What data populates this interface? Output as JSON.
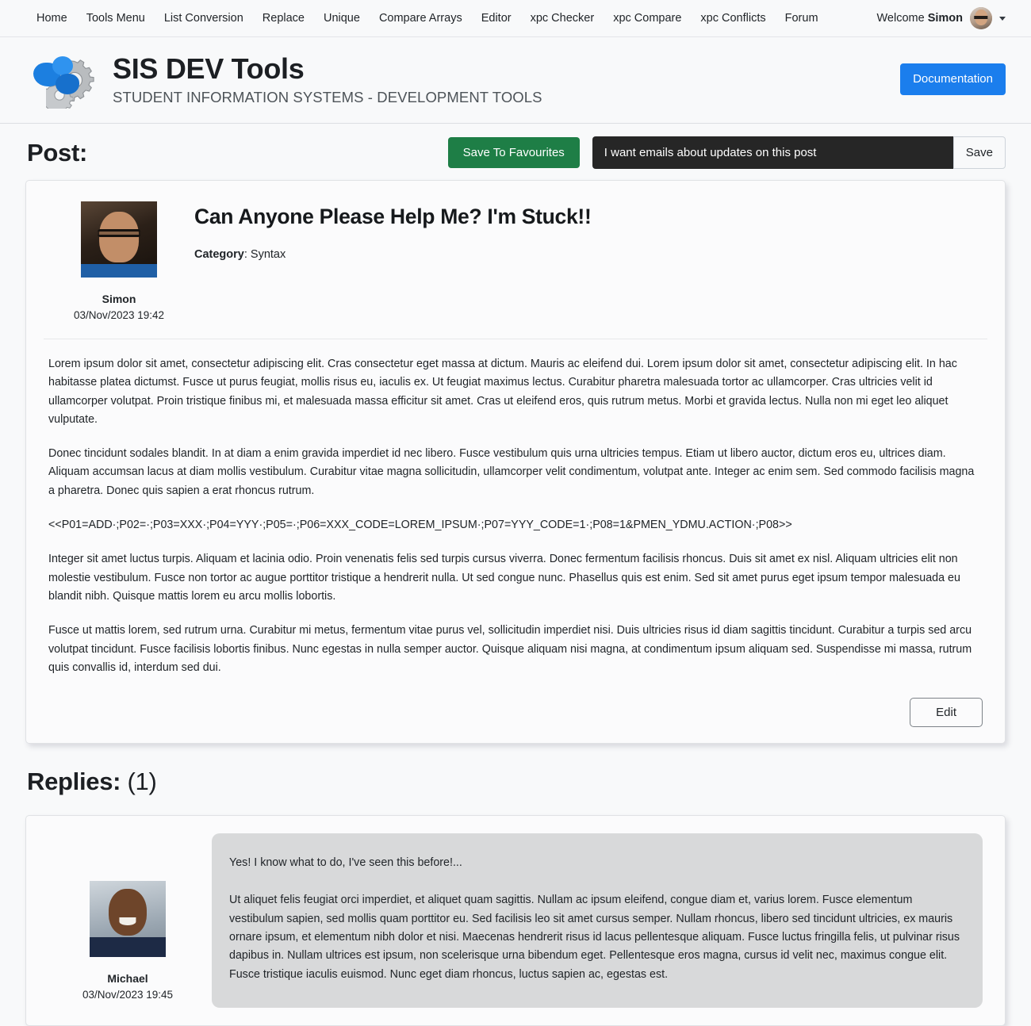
{
  "nav": {
    "links": [
      "Home",
      "Tools Menu",
      "List Conversion",
      "Replace",
      "Unique",
      "Compare Arrays",
      "Editor",
      "xpc Checker",
      "xpc Compare",
      "xpc Conflicts",
      "Forum"
    ],
    "welcome_prefix": "Welcome ",
    "welcome_user": "Simon"
  },
  "brand": {
    "title": "SIS DEV Tools",
    "subtitle": "STUDENT INFORMATION SYSTEMS - DEVELOPMENT TOOLS",
    "documentation_label": "Documentation",
    "accent_color": "#1b7eed"
  },
  "actions": {
    "post_heading": "Post:",
    "favourites_label": "Save To Favourites",
    "favourites_color": "#1e7e46",
    "email_optin_label": "I want emails about updates on this post",
    "save_label": "Save"
  },
  "post": {
    "title": "Can Anyone Please Help Me? I'm Stuck!!",
    "category_label": "Category",
    "category_value": "Syntax",
    "author": "Simon",
    "timestamp": "03/Nov/2023 19:42",
    "edit_label": "Edit",
    "paragraphs": [
      "Lorem ipsum dolor sit amet, consectetur adipiscing elit. Cras consectetur eget massa at dictum. Mauris ac eleifend dui. Lorem ipsum dolor sit amet, consectetur adipiscing elit. In hac habitasse platea dictumst. Fusce ut purus feugiat, mollis risus eu, iaculis ex. Ut feugiat maximus lectus. Curabitur pharetra malesuada tortor ac ullamcorper. Cras ultricies velit id ullamcorper volutpat. Proin tristique finibus mi, et malesuada massa efficitur sit amet. Cras ut eleifend eros, quis rutrum metus. Morbi et gravida lectus. Nulla non mi eget leo aliquet vulputate.",
      "Donec tincidunt sodales blandit. In at diam a enim gravida imperdiet id nec libero. Fusce vestibulum quis urna ultricies tempus. Etiam ut libero auctor, dictum eros eu, ultrices diam. Aliquam accumsan lacus at diam mollis vestibulum. Curabitur vitae magna sollicitudin, ullamcorper velit condimentum, volutpat ante. Integer ac enim sem. Sed commodo facilisis magna a pharetra. Donec quis sapien a erat rhoncus rutrum."
    ],
    "code_line": "<<P01=ADD·;P02=·;P03=XXX·;P04=YYY·;P05=·;P06=XXX_CODE=LOREM_IPSUM·;P07=YYY_CODE=1·;P08=1&PMEN_YDMU.ACTION·;P08>>",
    "paragraphs_after": [
      "Integer sit amet luctus turpis. Aliquam et lacinia odio. Proin venenatis felis sed turpis cursus viverra. Donec fermentum facilisis rhoncus. Duis sit amet ex nisl. Aliquam ultricies elit non molestie vestibulum. Fusce non tortor ac augue porttitor tristique a hendrerit nulla. Ut sed congue nunc. Phasellus quis est enim. Sed sit amet purus eget ipsum tempor malesuada eu blandit nibh. Quisque mattis lorem eu arcu mollis lobortis.",
      "Fusce ut mattis lorem, sed rutrum urna. Curabitur mi metus, fermentum vitae purus vel, sollicitudin imperdiet nisi. Duis ultricies risus id diam sagittis tincidunt. Curabitur a turpis sed arcu volutpat tincidunt. Fusce facilisis lobortis finibus. Nunc egestas in nulla semper auctor. Quisque aliquam nisi magna, at condimentum ipsum aliquam sed. Suspendisse mi massa, rutrum quis convallis id, interdum sed dui."
    ]
  },
  "replies": {
    "heading_label": "Replies:",
    "count_label": "(1)",
    "items": [
      {
        "author": "Michael",
        "timestamp": "03/Nov/2023 19:45",
        "paragraphs": [
          "Yes! I know what to do, I've seen this before!...",
          "Ut aliquet felis feugiat orci imperdiet, et aliquet quam sagittis. Nullam ac ipsum eleifend, congue diam et, varius lorem. Fusce elementum vestibulum sapien, sed mollis quam porttitor eu. Sed facilisis leo sit amet cursus semper. Nullam rhoncus, libero sed tincidunt ultricies, ex mauris ornare ipsum, et elementum nibh dolor et nisi. Maecenas hendrerit risus id lacus pellentesque aliquam. Fusce luctus fringilla felis, ut pulvinar risus dapibus in. Nullam ultrices est ipsum, non scelerisque urna bibendum eget. Pellentesque eros magna, cursus id velit nec, maximus congue elit. Fusce tristique iaculis euismod. Nunc eget diam rhoncus, luctus sapien ac, egestas est."
        ]
      }
    ]
  }
}
